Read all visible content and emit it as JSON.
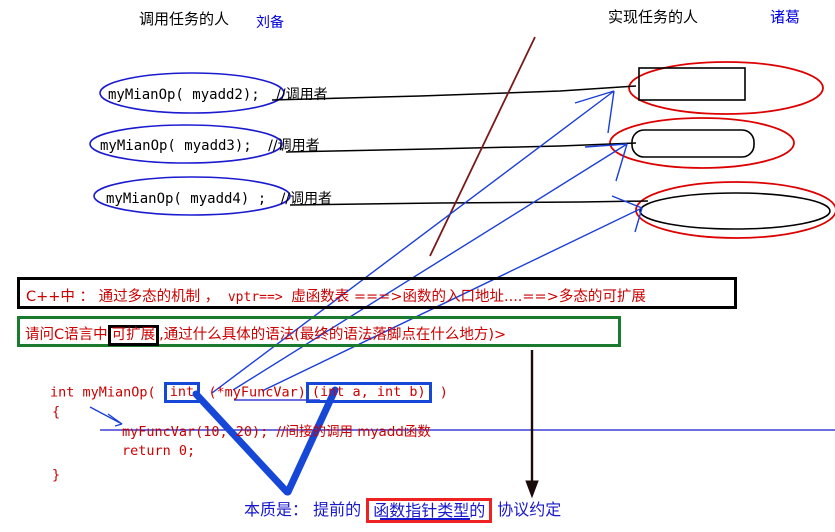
{
  "headers": {
    "caller_label": "调用任务的人",
    "caller_name": "刘备",
    "impl_label": "实现任务的人",
    "impl_name": "诸葛"
  },
  "calls": [
    {
      "code": "myMianOp( myadd2);",
      "comment": "//调用者"
    },
    {
      "code": "myMianOp( myadd3);",
      "comment": "//调用者"
    },
    {
      "code": "myMianOp( myadd4) ;",
      "comment": "//调用者"
    }
  ],
  "shapes": [
    {
      "name": "rectangle-shape",
      "note": ""
    },
    {
      "name": "rounded-rectangle-shape",
      "note": ""
    },
    {
      "name": "ellipse-shape",
      "note": ""
    }
  ],
  "note_black_box": {
    "text_a": "C++中 ： 通过多态的机制 ，",
    "text_b": "vptr==>",
    "text_c": "虚函数表 ===>函数的入口地址....==>多态的可扩展"
  },
  "note_green_box": {
    "text_a": "请问C语言中",
    "highlight": "可扩展",
    "text_b": ",通过什么具体的语法(最终的语法落脚点在什么地方)>"
  },
  "code": {
    "line1_a": "int myMianOp( ",
    "line1_box1": "int",
    "line1_b": " (*myFuncVar)",
    "line1_box2": "(int a, int b)",
    "line1_c": "   )",
    "line2": "{",
    "line3_a": "myFuncVar(10, 20);   ",
    "line3_b": "//间接的调用 myadd函数",
    "line4": "return 0;",
    "line5": "}"
  },
  "conclusion": {
    "prefix": "本质是： 提前的",
    "highlight": "函数指针类型的",
    "suffix": "协议约定"
  },
  "colors": {
    "red_text": "#cc0000",
    "blue_text": "#1717cc",
    "blue_ellipse": "#1a1ad0",
    "red_ellipse": "#dd0000",
    "green_border": "#1a7a2e",
    "black": "#000000",
    "maroon_line": "#7a1a1a",
    "thick_blue": "#1747d6"
  }
}
